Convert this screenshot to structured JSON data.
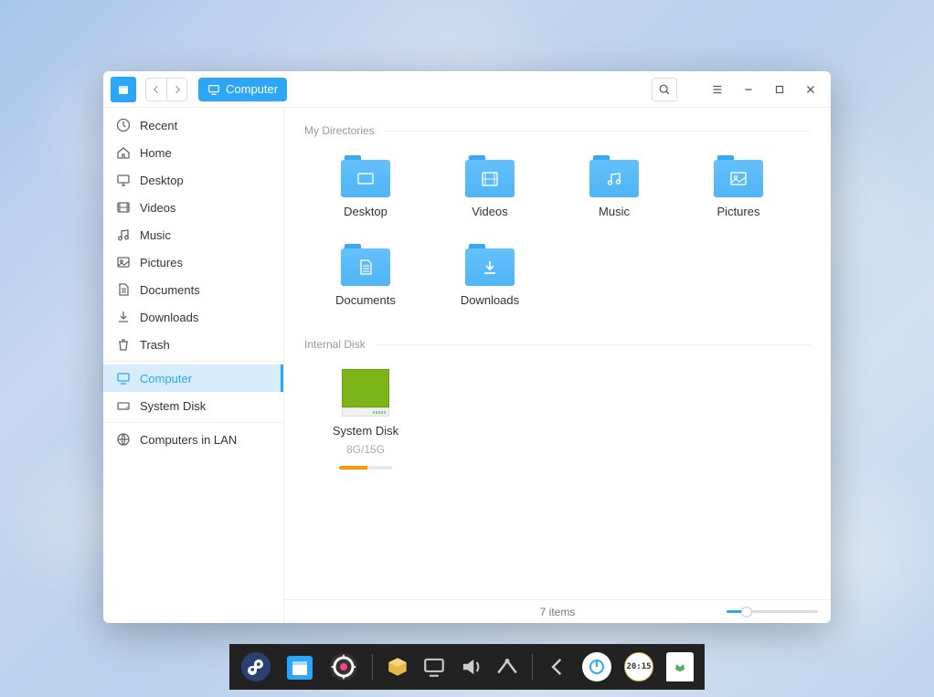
{
  "location": {
    "label": "Computer"
  },
  "sidebar": {
    "items": [
      {
        "label": "Recent",
        "icon": "clock"
      },
      {
        "label": "Home",
        "icon": "home"
      },
      {
        "label": "Desktop",
        "icon": "desktop"
      },
      {
        "label": "Videos",
        "icon": "video"
      },
      {
        "label": "Music",
        "icon": "music"
      },
      {
        "label": "Pictures",
        "icon": "picture"
      },
      {
        "label": "Documents",
        "icon": "document"
      },
      {
        "label": "Downloads",
        "icon": "download"
      },
      {
        "label": "Trash",
        "icon": "trash"
      }
    ],
    "items2": [
      {
        "label": "Computer",
        "icon": "computer",
        "active": true
      },
      {
        "label": "System Disk",
        "icon": "disk"
      }
    ],
    "items3": [
      {
        "label": "Computers in LAN",
        "icon": "network"
      }
    ]
  },
  "sections": {
    "directories": {
      "label": "My Directories",
      "items": [
        {
          "label": "Desktop",
          "glyph": "desktop"
        },
        {
          "label": "Videos",
          "glyph": "video"
        },
        {
          "label": "Music",
          "glyph": "music"
        },
        {
          "label": "Pictures",
          "glyph": "picture"
        },
        {
          "label": "Documents",
          "glyph": "document"
        },
        {
          "label": "Downloads",
          "glyph": "download"
        }
      ]
    },
    "disks": {
      "label": "Internal Disk",
      "items": [
        {
          "label": "System Disk",
          "usage": "8G/15G",
          "pct": 53
        }
      ]
    }
  },
  "status": {
    "count": "7 items"
  },
  "dock": {
    "clock": "20:15"
  },
  "colors": {
    "accent": "#2ca7f8"
  }
}
